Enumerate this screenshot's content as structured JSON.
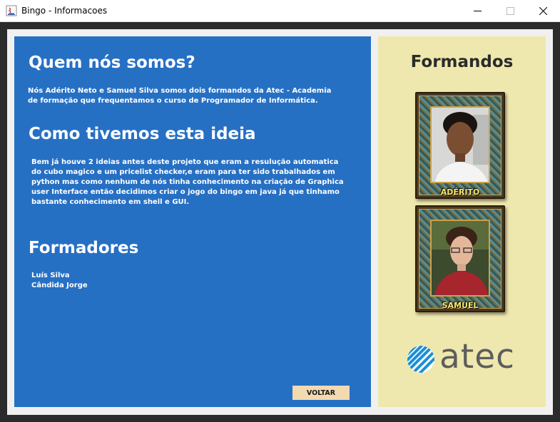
{
  "window": {
    "title": "Bingo - Informacoes",
    "minimize_glyph": "—",
    "maximize_glyph": "☐",
    "close_glyph": "✕"
  },
  "left": {
    "heading_who": "Quem nós somos?",
    "who_text_1": "Nós Adérito Neto e Samuel Silva somos dois formandos da Atec - Academia",
    "who_text_2": "de formação que frequentamos o curso de Programador de Informática.",
    "heading_idea": "Como tivemos esta ideia",
    "idea_lines": [
      "Bem já houve 2 ideias antes deste projeto que eram a resulução automatica",
      "do cubo magico e um pricelist checker,e eram para ter sido trabalhados em",
      "python mas como nenhum de nós tinha conhecimento na criação de Graphica",
      "user Interface então decidimos criar o jogo do bingo em java já que  tinhamo",
      "bastante conhecimento em shell e GUI."
    ],
    "heading_formadores": "Formadores",
    "formadores": [
      "Luís Silva",
      "Cândida Jorge"
    ],
    "voltar_label": "VOLTAR"
  },
  "right": {
    "title": "Formandos",
    "people": [
      {
        "name": "ADÉRITO"
      },
      {
        "name": "SAMUEL"
      }
    ],
    "logo_text": "atec",
    "logo_color": "#1b8fd6"
  }
}
